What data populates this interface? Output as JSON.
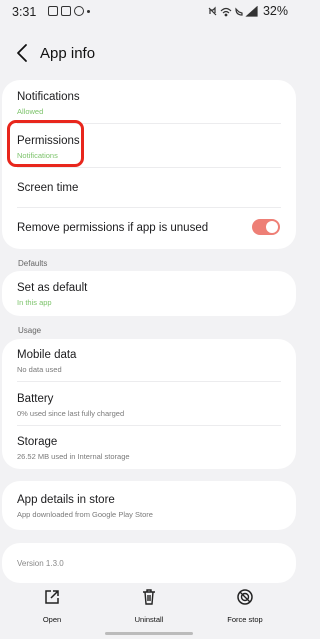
{
  "status_bar": {
    "time": "3:31",
    "battery": "32%"
  },
  "header": {
    "title": "App info"
  },
  "main": {
    "notifications": {
      "title": "Notifications",
      "subtitle": "Allowed"
    },
    "permissions": {
      "title": "Permissions",
      "subtitle": "Notifications"
    },
    "screen_time": {
      "title": "Screen time"
    },
    "remove_permissions": {
      "title": "Remove permissions if app is unused",
      "toggle_on": true
    },
    "defaults_section": "Defaults",
    "set_default": {
      "title": "Set as default",
      "subtitle": "In this app"
    },
    "usage_section": "Usage",
    "mobile_data": {
      "title": "Mobile data",
      "subtitle": "No data used"
    },
    "battery": {
      "title": "Battery",
      "subtitle": "0% used since last fully charged"
    },
    "storage": {
      "title": "Storage",
      "subtitle": "26.52 MB used in Internal storage"
    },
    "store": {
      "title": "App details in store",
      "subtitle": "App downloaded from Google Play Store"
    },
    "version": "Version 1.3.0"
  },
  "bottom_bar": {
    "open_label": "Open",
    "uninstall_label": "Uninstall",
    "force_stop_label": "Force stop"
  },
  "colors": {
    "accent_green": "#7cc36a",
    "toggle_on": "#ee7f76",
    "highlight_red": "#e8261c"
  }
}
